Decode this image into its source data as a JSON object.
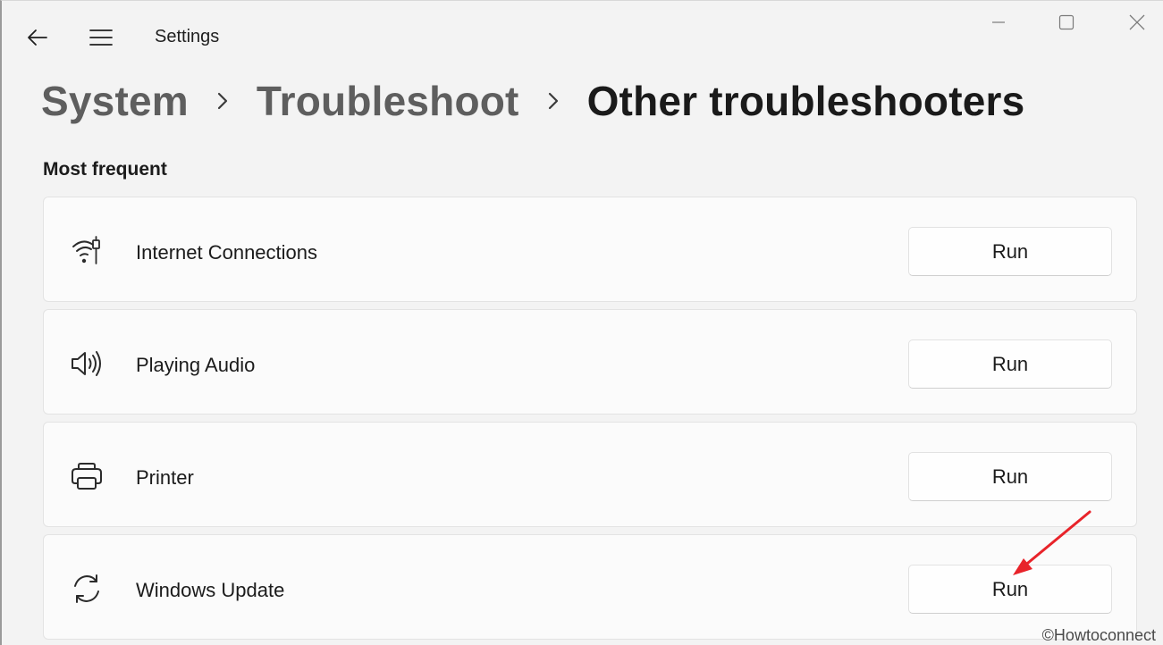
{
  "window": {
    "title": "Settings"
  },
  "breadcrumb": {
    "items": [
      "System",
      "Troubleshoot"
    ],
    "current": "Other troubleshooters"
  },
  "section": {
    "title": "Most frequent"
  },
  "troubleshooters": [
    {
      "label": "Internet Connections",
      "icon": "wifi-ethernet-icon",
      "button": "Run"
    },
    {
      "label": "Playing Audio",
      "icon": "speaker-icon",
      "button": "Run"
    },
    {
      "label": "Printer",
      "icon": "printer-icon",
      "button": "Run"
    },
    {
      "label": "Windows Update",
      "icon": "sync-icon",
      "button": "Run"
    }
  ],
  "watermark": "©Howtoconnect",
  "colors": {
    "background": "#f3f3f3",
    "card": "#fbfbfb",
    "annotation_arrow": "#e8232a"
  }
}
